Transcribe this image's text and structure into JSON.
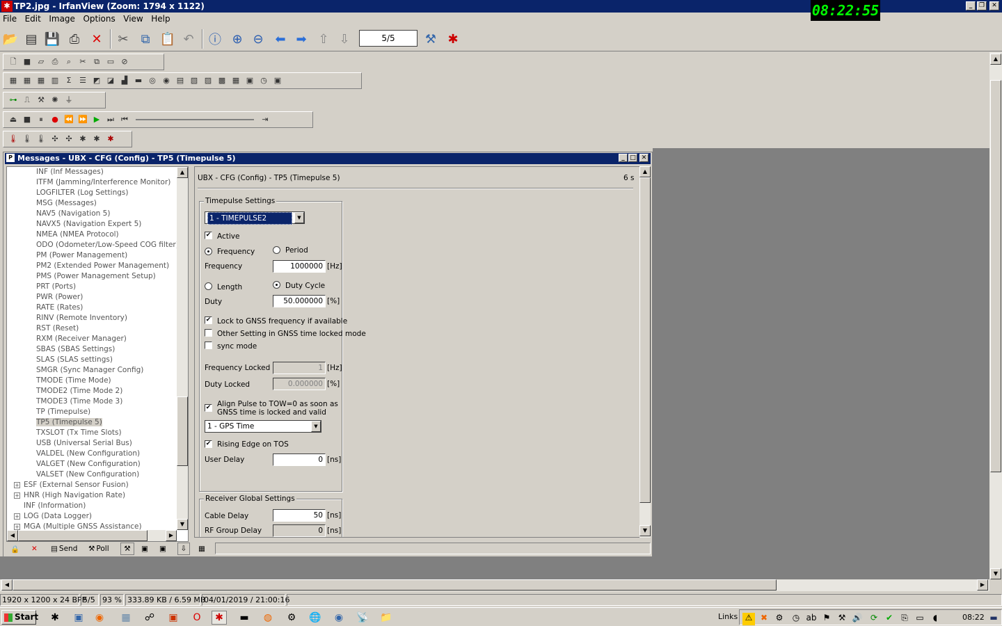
{
  "window": {
    "title": "TP2.jpg - IrfanView (Zoom: 1794 x 1122)"
  },
  "clock": "08:22:55",
  "menu": [
    "File",
    "Edit",
    "Image",
    "Options",
    "View",
    "Help"
  ],
  "toolbar": {
    "page_indicator": "5/5",
    "icons": [
      "open-icon",
      "thumbnails-icon",
      "save-icon",
      "print-icon",
      "delete-icon",
      "cut-icon",
      "copy-icon",
      "paste-icon",
      "undo-icon",
      "info-icon",
      "zoom-in-icon",
      "zoom-out-icon",
      "previous-icon",
      "next-icon",
      "first-page-icon",
      "last-page-icon",
      "settings-icon",
      "irfanview-icon"
    ]
  },
  "messages_window": {
    "title": "Messages - UBX - CFG (Config) - TP5 (Timepulse 5)",
    "tree_items": [
      {
        "label": "INF (Inf Messages)",
        "level": 2
      },
      {
        "label": "ITFM (Jamming/Interference Monitor)",
        "level": 2
      },
      {
        "label": "LOGFILTER (Log Settings)",
        "level": 2
      },
      {
        "label": "MSG (Messages)",
        "level": 2
      },
      {
        "label": "NAV5 (Navigation 5)",
        "level": 2
      },
      {
        "label": "NAVX5 (Navigation Expert 5)",
        "level": 2
      },
      {
        "label": "NMEA (NMEA Protocol)",
        "level": 2
      },
      {
        "label": "ODO (Odometer/Low-Speed COG filter)",
        "level": 2
      },
      {
        "label": "PM (Power Management)",
        "level": 2
      },
      {
        "label": "PM2 (Extended Power Management)",
        "level": 2
      },
      {
        "label": "PMS (Power Management Setup)",
        "level": 2
      },
      {
        "label": "PRT (Ports)",
        "level": 2
      },
      {
        "label": "PWR (Power)",
        "level": 2
      },
      {
        "label": "RATE (Rates)",
        "level": 2
      },
      {
        "label": "RINV (Remote Inventory)",
        "level": 2
      },
      {
        "label": "RST (Reset)",
        "level": 2
      },
      {
        "label": "RXM (Receiver Manager)",
        "level": 2
      },
      {
        "label": "SBAS (SBAS Settings)",
        "level": 2
      },
      {
        "label": "SLAS (SLAS settings)",
        "level": 2
      },
      {
        "label": "SMGR (Sync Manager Config)",
        "level": 2
      },
      {
        "label": "TMODE (Time Mode)",
        "level": 2
      },
      {
        "label": "TMODE2 (Time Mode 2)",
        "level": 2
      },
      {
        "label": "TMODE3 (Time Mode 3)",
        "level": 2
      },
      {
        "label": "TP (Timepulse)",
        "level": 2
      },
      {
        "label": "TP5 (Timepulse 5)",
        "level": 2,
        "selected": true
      },
      {
        "label": "TXSLOT (Tx Time Slots)",
        "level": 2
      },
      {
        "label": "USB (Universal Serial Bus)",
        "level": 2
      },
      {
        "label": "VALDEL (New Configuration)",
        "level": 2
      },
      {
        "label": "VALGET (New Configuration)",
        "level": 2
      },
      {
        "label": "VALSET (New Configuration)",
        "level": 2
      },
      {
        "label": "ESF (External Sensor Fusion)",
        "level": 1,
        "expandable": true
      },
      {
        "label": "HNR (High Navigation Rate)",
        "level": 1,
        "expandable": true
      },
      {
        "label": "INF (Information)",
        "level": 1,
        "expandable": false
      },
      {
        "label": "LOG (Data Logger)",
        "level": 1,
        "expandable": true
      },
      {
        "label": "MGA (Multiple GNSS Assistance)",
        "level": 1,
        "expandable": true
      }
    ],
    "panel": {
      "header": "UBX - CFG (Config) - TP5 (Timepulse 5)",
      "age": "6 s",
      "timepulse_group": "Timepulse Settings",
      "timepulse_select": "1 - TIMEPULSE2",
      "active_label": "Active",
      "active_checked": true,
      "frequency_radio": "Frequency",
      "period_radio": "Period",
      "frequency_label": "Frequency",
      "frequency_value": "1000000",
      "frequency_unit": "[Hz]",
      "length_radio": "Length",
      "duty_cycle_radio": "Duty Cycle",
      "duty_label": "Duty",
      "duty_value": "50.000000",
      "duty_unit": "[%]",
      "lock_gnss_label": "Lock to GNSS frequency if available",
      "lock_gnss_checked": true,
      "other_setting_label": "Other Setting in GNSS time locked mode",
      "other_setting_checked": false,
      "sync_mode_label": "sync mode",
      "sync_mode_checked": false,
      "freq_locked_label": "Frequency Locked",
      "freq_locked_value": "1",
      "freq_locked_unit": "[Hz]",
      "duty_locked_label": "Duty Locked",
      "duty_locked_value": "0.000000",
      "duty_locked_unit": "[%]",
      "align_label_1": "Align Pulse to TOW=0 as soon as",
      "align_label_2": "GNSS time is locked and valid",
      "align_checked": true,
      "time_select": "1 - GPS Time",
      "rising_edge_label": "Rising Edge on TOS",
      "rising_edge_checked": true,
      "user_delay_label": "User Delay",
      "user_delay_value": "0",
      "user_delay_unit": "[ns]",
      "receiver_group": "Receiver Global Settings",
      "cable_delay_label": "Cable Delay",
      "cable_delay_value": "50",
      "cable_delay_unit": "[ns]",
      "rf_delay_label": "RF Group Delay",
      "rf_delay_value": "0",
      "rf_delay_unit": "[ns]"
    },
    "bottom_toolbar": {
      "send": "Send",
      "poll": "Poll"
    }
  },
  "statusbar": {
    "dimensions": "1920 x 1200 x 24 BPP",
    "page": "5/5",
    "zoom": "93 %",
    "size": "333.89 KB / 6.59 MB",
    "datetime": "04/01/2019 / 21:00:16"
  },
  "taskbar": {
    "start": "Start",
    "links": "Links",
    "time": "08:22"
  }
}
